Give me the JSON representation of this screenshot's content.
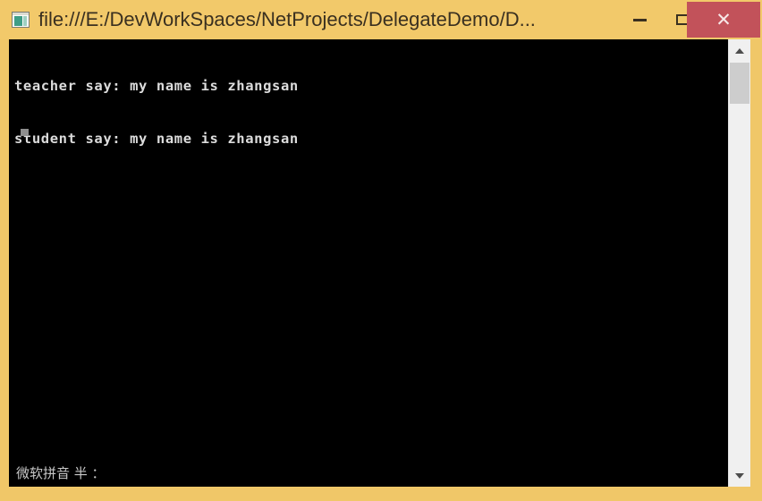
{
  "window": {
    "title": "file:///E:/DevWorkSpaces/NetProjects/DelegateDemo/D...",
    "icon_name": "console-window-icon",
    "frame_color": "#f0c768",
    "titlebar_color": "#f2c96a",
    "title_text_color": "#3a3020"
  },
  "controls": {
    "minimize_label": "—",
    "maximize_label": "□",
    "close_label": "✕",
    "close_color": "#c2525a"
  },
  "console": {
    "background": "#000000",
    "text_color": "#dcdcdc",
    "lines": [
      "teacher say: my name is zhangsan",
      "student say: my name is zhangsan"
    ],
    "cursor_visible": true
  },
  "ime": {
    "status_text": "微软拼音 半 ："
  },
  "scrollbar": {
    "up_arrow": "▲",
    "down_arrow": "▼",
    "track_color": "#f0f0f0",
    "thumb_color": "#cdcdcd"
  }
}
